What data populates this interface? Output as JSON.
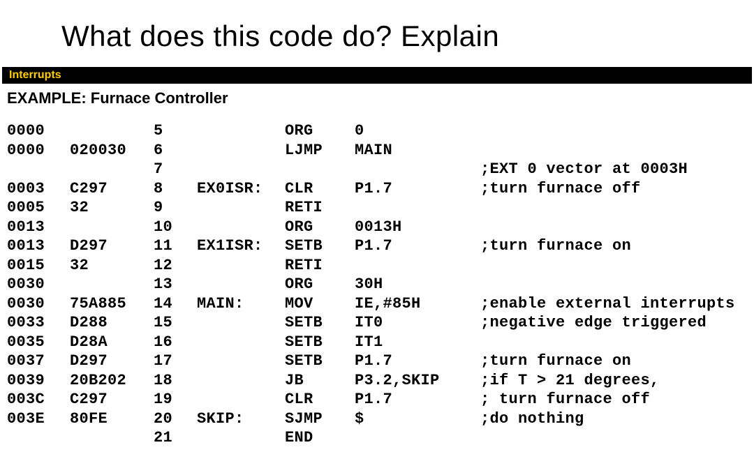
{
  "title": "What does this code do?  Explain",
  "section_bar": "Interrupts",
  "subtitle": "EXAMPLE: Furnace Controller",
  "code": {
    "rows": [
      {
        "addr": "0000",
        "obj": "",
        "ln": "5",
        "label": "",
        "mnem": "ORG",
        "op": "0",
        "cmt": ""
      },
      {
        "addr": "0000",
        "obj": "020030",
        "ln": "6",
        "label": "",
        "mnem": "LJMP",
        "op": "MAIN",
        "cmt": ""
      },
      {
        "addr": "",
        "obj": "",
        "ln": "7",
        "label": "",
        "mnem": "",
        "op": "",
        "cmt": ";EXT 0 vector at 0003H"
      },
      {
        "addr": "0003",
        "obj": "C297",
        "ln": "8",
        "label": "EX0ISR:",
        "mnem": "CLR",
        "op": "P1.7",
        "cmt": ";turn furnace off"
      },
      {
        "addr": "0005",
        "obj": "32",
        "ln": "9",
        "label": "",
        "mnem": "RETI",
        "op": "",
        "cmt": ""
      },
      {
        "addr": "0013",
        "obj": "",
        "ln": "10",
        "label": "",
        "mnem": "ORG",
        "op": "0013H",
        "cmt": ""
      },
      {
        "addr": "0013",
        "obj": "D297",
        "ln": "11",
        "label": "EX1ISR:",
        "mnem": "SETB",
        "op": "P1.7",
        "cmt": ";turn furnace on"
      },
      {
        "addr": "0015",
        "obj": "32",
        "ln": "12",
        "label": "",
        "mnem": "RETI",
        "op": "",
        "cmt": ""
      },
      {
        "addr": "0030",
        "obj": "",
        "ln": "13",
        "label": "",
        "mnem": "ORG",
        "op": "30H",
        "cmt": ""
      },
      {
        "addr": "0030",
        "obj": "75A885",
        "ln": "14",
        "label": "MAIN:",
        "mnem": "MOV",
        "op": "IE,#85H",
        "cmt": ";enable external interrupts"
      },
      {
        "addr": "0033",
        "obj": "D288",
        "ln": "15",
        "label": "",
        "mnem": "SETB",
        "op": "IT0",
        "cmt": ";negative edge triggered"
      },
      {
        "addr": "0035",
        "obj": "D28A",
        "ln": "16",
        "label": "",
        "mnem": "SETB",
        "op": "IT1",
        "cmt": ""
      },
      {
        "addr": "0037",
        "obj": "D297",
        "ln": "17",
        "label": "",
        "mnem": "SETB",
        "op": "P1.7",
        "cmt": ";turn furnace on"
      },
      {
        "addr": "0039",
        "obj": "20B202",
        "ln": "18",
        "label": "",
        "mnem": "JB",
        "op": "P3.2,SKIP",
        "cmt": ";if T > 21 degrees,"
      },
      {
        "addr": "003C",
        "obj": "C297",
        "ln": "19",
        "label": "",
        "mnem": "CLR",
        "op": "P1.7",
        "cmt": "; turn furnace off"
      },
      {
        "addr": "003E",
        "obj": "80FE",
        "ln": "20",
        "label": "SKIP:",
        "mnem": "SJMP",
        "op": "$",
        "cmt": ";do nothing"
      },
      {
        "addr": "",
        "obj": "",
        "ln": "21",
        "label": "",
        "mnem": "END",
        "op": "",
        "cmt": ""
      }
    ]
  }
}
